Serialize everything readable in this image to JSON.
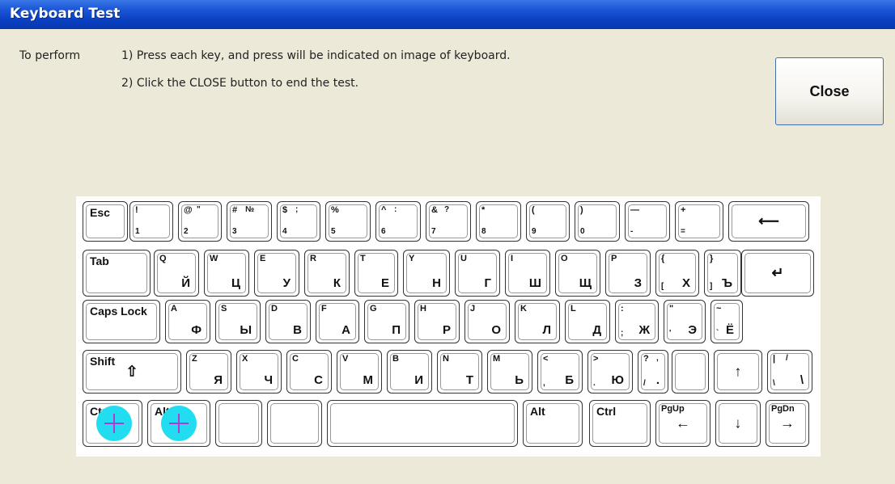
{
  "window": {
    "title": "Keyboard Test"
  },
  "instructions": {
    "label": "To perform",
    "step1": "1) Press each key, and press will be indicated on image of keyboard.",
    "step2": "2) Click the CLOSE button to end the test."
  },
  "close_button": {
    "label": "Close"
  },
  "keyboard": {
    "row1": [
      {
        "id": "esc",
        "mod": "Esc"
      },
      {
        "id": "1",
        "tl": "!",
        "bl": "1"
      },
      {
        "id": "2",
        "tl": "@",
        "tr": "\"",
        "bl": "2"
      },
      {
        "id": "3",
        "tl": "#",
        "tr": "№",
        "bl": "3"
      },
      {
        "id": "4",
        "tl": "$",
        "tr": ";",
        "bl": "4"
      },
      {
        "id": "5",
        "tl": "%",
        "bl": "5"
      },
      {
        "id": "6",
        "tl": "^",
        "tr": ":",
        "bl": "6"
      },
      {
        "id": "7",
        "tl": "&",
        "tr": "?",
        "bl": "7"
      },
      {
        "id": "8",
        "tl": "*",
        "bl": "8"
      },
      {
        "id": "9",
        "tl": "(",
        "bl": "9"
      },
      {
        "id": "0",
        "tl": ")",
        "bl": "0"
      },
      {
        "id": "minus",
        "tl": "—",
        "bl": "-"
      },
      {
        "id": "equal",
        "tl": "+",
        "bl": "="
      },
      {
        "id": "backspace",
        "mid": "⟵"
      }
    ],
    "row2": [
      {
        "id": "tab",
        "mod": "Tab"
      },
      {
        "id": "q",
        "tl": "Q",
        "br": "Й"
      },
      {
        "id": "w",
        "tl": "W",
        "br": "Ц"
      },
      {
        "id": "e",
        "tl": "E",
        "br": "У"
      },
      {
        "id": "r",
        "tl": "R",
        "br": "К"
      },
      {
        "id": "t",
        "tl": "T",
        "br": "Е"
      },
      {
        "id": "y",
        "tl": "Y",
        "br": "Н"
      },
      {
        "id": "u",
        "tl": "U",
        "br": "Г"
      },
      {
        "id": "i",
        "tl": "I",
        "br": "Ш"
      },
      {
        "id": "o",
        "tl": "O",
        "br": "Щ"
      },
      {
        "id": "p",
        "tl": "P",
        "br": "З"
      },
      {
        "id": "lbracket",
        "tl": "{",
        "bl": "[",
        "br": "Х"
      },
      {
        "id": "rbracket",
        "tl": "}",
        "bl": "]",
        "br": "Ъ"
      },
      {
        "id": "enter",
        "mid": "↵"
      }
    ],
    "row3": [
      {
        "id": "caps",
        "mod": "Caps Lock"
      },
      {
        "id": "a",
        "tl": "A",
        "br": "Ф"
      },
      {
        "id": "s",
        "tl": "S",
        "br": "Ы"
      },
      {
        "id": "d",
        "tl": "D",
        "br": "В"
      },
      {
        "id": "f",
        "tl": "F",
        "br": "А"
      },
      {
        "id": "g",
        "tl": "G",
        "br": "П"
      },
      {
        "id": "h",
        "tl": "H",
        "br": "Р"
      },
      {
        "id": "j",
        "tl": "J",
        "br": "О"
      },
      {
        "id": "k",
        "tl": "K",
        "br": "Л"
      },
      {
        "id": "l",
        "tl": "L",
        "br": "Д"
      },
      {
        "id": "semicolon",
        "tl": ":",
        "bl": ";",
        "br": "Ж"
      },
      {
        "id": "quote",
        "tl": "\"",
        "bl": "'",
        "br": "Э"
      },
      {
        "id": "tilde",
        "tl": "~",
        "bl": "`",
        "br": "Ё"
      }
    ],
    "row4": [
      {
        "id": "shift",
        "mod": "Shift",
        "mid": "⇧"
      },
      {
        "id": "z",
        "tl": "Z",
        "br": "Я"
      },
      {
        "id": "x",
        "tl": "X",
        "br": "Ч"
      },
      {
        "id": "c",
        "tl": "C",
        "br": "С"
      },
      {
        "id": "v",
        "tl": "V",
        "br": "М"
      },
      {
        "id": "b",
        "tl": "B",
        "br": "И"
      },
      {
        "id": "n",
        "tl": "N",
        "br": "Т"
      },
      {
        "id": "m",
        "tl": "M",
        "br": "Ь"
      },
      {
        "id": "comma",
        "tl": "<",
        "bl": ",",
        "br": "Б"
      },
      {
        "id": "period",
        "tl": ">",
        "bl": ".",
        "br": "Ю"
      },
      {
        "id": "slash",
        "tl": "?",
        "tr": ",",
        "bl": "/",
        "br": "."
      },
      {
        "id": "blank4",
        "mid": ""
      },
      {
        "id": "up",
        "mid": "↑"
      },
      {
        "id": "backslash",
        "tl": "|",
        "tr": "/",
        "bl": "\\",
        "br": "\\"
      }
    ],
    "row5": [
      {
        "id": "ctrl-left",
        "mod": "Ctrl",
        "pressed": true
      },
      {
        "id": "alt-left",
        "mod": "Alt",
        "pressed": true
      },
      {
        "id": "blank-a",
        "mid": ""
      },
      {
        "id": "blank-b",
        "mid": ""
      },
      {
        "id": "space",
        "mid": ""
      },
      {
        "id": "alt-right",
        "mod": "Alt"
      },
      {
        "id": "ctrl-right",
        "mod": "Ctrl"
      },
      {
        "id": "pgup",
        "tl": "PgUp",
        "mid": "←"
      },
      {
        "id": "down",
        "mid": "↓"
      },
      {
        "id": "pgdn",
        "tl": "PgDn",
        "mid": "→"
      }
    ]
  },
  "pressed_indicator_color": "#22dcf0",
  "pressed_cross_color": "#b03ad6"
}
